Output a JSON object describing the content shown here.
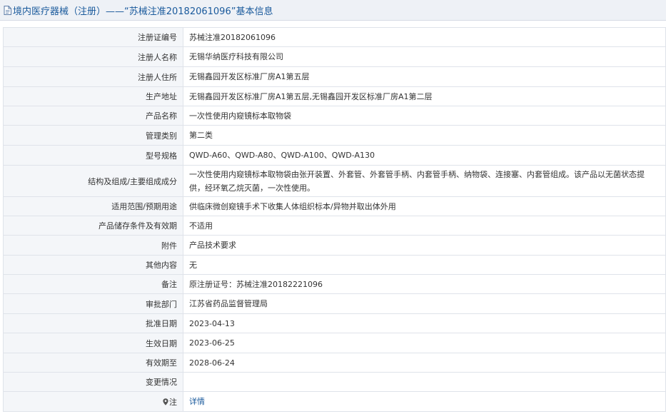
{
  "header": {
    "title": "境内医疗器械（注册）——“苏械注准20182061096”基本信息"
  },
  "rows": [
    {
      "label": "注册证编号",
      "value": "苏械注准20182061096"
    },
    {
      "label": "注册人名称",
      "value": "无锡华纳医疗科技有限公司"
    },
    {
      "label": "注册人住所",
      "value": "无锡鑫园开发区标准厂房A1第五层"
    },
    {
      "label": "生产地址",
      "value": "无锡鑫园开发区标准厂房A1第五层,无锡鑫园开发区标准厂房A1第二层"
    },
    {
      "label": "产品名称",
      "value": "一次性使用内窥镜标本取物袋"
    },
    {
      "label": "管理类别",
      "value": "第二类"
    },
    {
      "label": "型号规格",
      "value": "QWD-A60、QWD-A80、QWD-A100、QWD-A130"
    },
    {
      "label": "结构及组成/主要组成成分",
      "value": "一次性使用内窥镜标本取物袋由张开装置、外套管、外套管手柄、内套管手柄、纳物袋、连接塞、内套管组成。该产品以无菌状态提供，经环氧乙烷灭菌，一次性使用。"
    },
    {
      "label": "适用范围/预期用途",
      "value": "供临床微创窥镜手术下收集人体组织标本/异物并取出体外用"
    },
    {
      "label": "产品储存条件及有效期",
      "value": "不适用"
    },
    {
      "label": "附件",
      "value": "产品技术要求"
    },
    {
      "label": "其他内容",
      "value": "无"
    },
    {
      "label": "备注",
      "value": "原注册证号：苏械注准20182221096"
    },
    {
      "label": "审批部门",
      "value": "江苏省药品监督管理局"
    },
    {
      "label": "批准日期",
      "value": "2023-04-13"
    },
    {
      "label": "生效日期",
      "value": "2023-06-25"
    },
    {
      "label": "有效期至",
      "value": "2028-06-24"
    },
    {
      "label": "变更情况",
      "value": ""
    }
  ],
  "note": {
    "label": "注",
    "icon": "location-pin-icon",
    "link_text": "详情"
  },
  "colors": {
    "title_text": "#1a5a9c",
    "link": "#1a5a9c",
    "label_bg": "#f4f6f9",
    "border": "#dfe3ea"
  }
}
